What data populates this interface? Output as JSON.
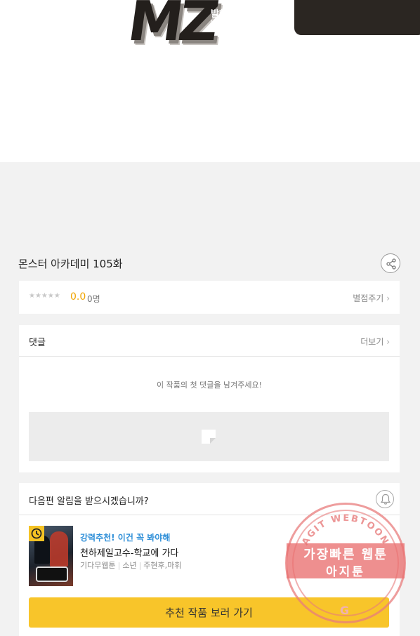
{
  "publisher_logo": {
    "letters": "MZ",
    "publisher": "발행 (주)엠젯패밀리",
    "url": "http://mzfamily.co.kr"
  },
  "episode": {
    "title": "몬스터 아카데미 105화",
    "share_icon": "share-icon"
  },
  "rating": {
    "stars": "★★★★★",
    "stars_filled": 0,
    "score": "0.0",
    "count": "0명",
    "rate_link": "별점주기"
  },
  "comments": {
    "title": "댓글",
    "more_link": "더보기",
    "empty_message": "이 작품의 첫 댓글을 남겨주세요!"
  },
  "notify": {
    "question": "다음편 알림을 받으시겠습니까?",
    "bell_icon": "bell-icon"
  },
  "recommendation": {
    "tag": "강력추천! 이건 꼭 봐야해",
    "title": "천하제일고수-학교에 가다",
    "meta": [
      "기다무웹툰",
      "소년",
      "주현후,마휘"
    ],
    "button_label": "추천 작품 보러 가기"
  },
  "watermark": {
    "arc_text": "AGIT WEBTOON",
    "line1": "가장빠른 웹툰",
    "line2": "아지툰"
  },
  "colors": {
    "accent_yellow": "#f8c52a",
    "rating_orange": "#f0a400",
    "link_blue": "#2f8fd8",
    "watermark_red": "#e96f6f"
  }
}
